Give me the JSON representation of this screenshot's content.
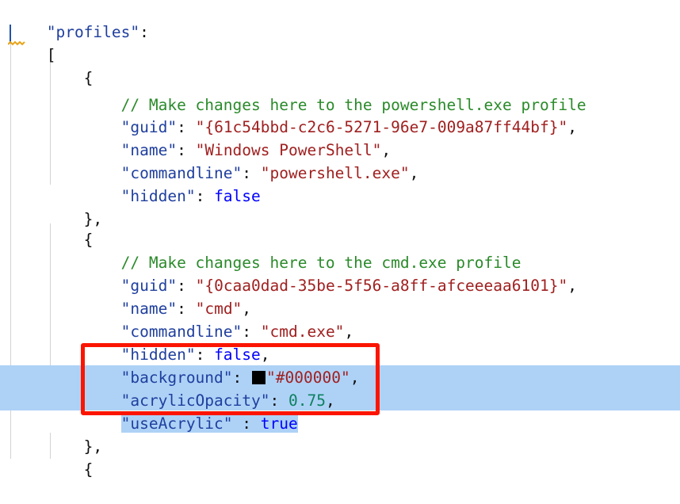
{
  "editor": {
    "language": "jsonc",
    "background_color": "#ffffff",
    "selection_color": "#aed2f6",
    "indent_guide_color": "#d3d3d3",
    "caret_color": "#2154a8",
    "annotation_color": "#fb1500",
    "squiggle_color": "#e8a317",
    "token_colors": {
      "property": "#1f3f9e",
      "string": "#a02020",
      "comment": "#2a8a2a",
      "keyword": "#0000ff",
      "number": "#0e8060",
      "punctuation": "#101010"
    }
  },
  "code": {
    "lines": [
      {
        "indent": "",
        "text": "\"profiles\":"
      },
      {
        "indent": "",
        "text": "["
      },
      {
        "indent": "    ",
        "text": "{"
      },
      {
        "indent": "        ",
        "text": "// Make changes here to the powershell.exe profile"
      },
      {
        "indent": "        ",
        "text": "\"guid\": \"{61c54bbd-c2c6-5271-96e7-009a87ff44bf}\","
      },
      {
        "indent": "        ",
        "text": "\"name\": \"Windows PowerShell\","
      },
      {
        "indent": "        ",
        "text": "\"commandline\": \"powershell.exe\","
      },
      {
        "indent": "        ",
        "text": "\"hidden\": false"
      },
      {
        "indent": "    ",
        "text": "},"
      },
      {
        "indent": "    ",
        "text": "{"
      },
      {
        "indent": "        ",
        "text": "// Make changes here to the cmd.exe profile"
      },
      {
        "indent": "        ",
        "text": "\"guid\": \"{0caa0dad-35be-5f56-a8ff-afceeeaa6101}\","
      },
      {
        "indent": "        ",
        "text": "\"name\": \"cmd\","
      },
      {
        "indent": "        ",
        "text": "\"commandline\": \"cmd.exe\","
      },
      {
        "indent": "        ",
        "text": "\"hidden\": false,"
      },
      {
        "indent": "        ",
        "text": "\"background\": \"#000000\","
      },
      {
        "indent": "        ",
        "text": "\"acrylicOpacity\": 0.75,"
      },
      {
        "indent": "        ",
        "text": "\"useAcrylic\" : true"
      },
      {
        "indent": "    ",
        "text": "},"
      },
      {
        "indent": "    ",
        "text": "{"
      }
    ],
    "tokens": {
      "key_profiles": "\"profiles\"",
      "key_guid": "\"guid\"",
      "key_name": "\"name\"",
      "key_commandline": "\"commandline\"",
      "key_hidden": "\"hidden\"",
      "key_background": "\"background\"",
      "key_acrylicopacity": "\"acrylicOpacity\"",
      "key_useacrylic": "\"useAcrylic\"",
      "comment_powershell": "// Make changes here to the powershell.exe profile",
      "comment_cmd": "// Make changes here to the cmd.exe profile",
      "val_guid_ps": "\"{61c54bbd-c2c6-5271-96e7-009a87ff44bf}\"",
      "val_guid_cmd": "\"{0caa0dad-35be-5f56-a8ff-afceeeaa6101}\"",
      "val_name_ps": "\"Windows PowerShell\"",
      "val_name_cmd": "\"cmd\"",
      "val_cmdline_ps": "\"powershell.exe\"",
      "val_cmdline_cmd": "\"cmd.exe\"",
      "val_false": "false",
      "val_true": "true",
      "val_background": "\"#000000\"",
      "val_acrylicopacity": "0.75",
      "colon": ":",
      "colon_spaced": " :",
      "comma": ",",
      "bracket_open": "[",
      "brace_open": "{",
      "brace_close_comma": "},"
    }
  },
  "annotation": {
    "kind": "red-rectangle-highlight",
    "targets": [
      "\"background\": \"#000000\",",
      "\"acrylicOpacity\": 0.75,",
      "\"useAcrylic\" : true"
    ]
  },
  "color_swatch": {
    "name": "background-color-swatch",
    "value": "#000000"
  }
}
